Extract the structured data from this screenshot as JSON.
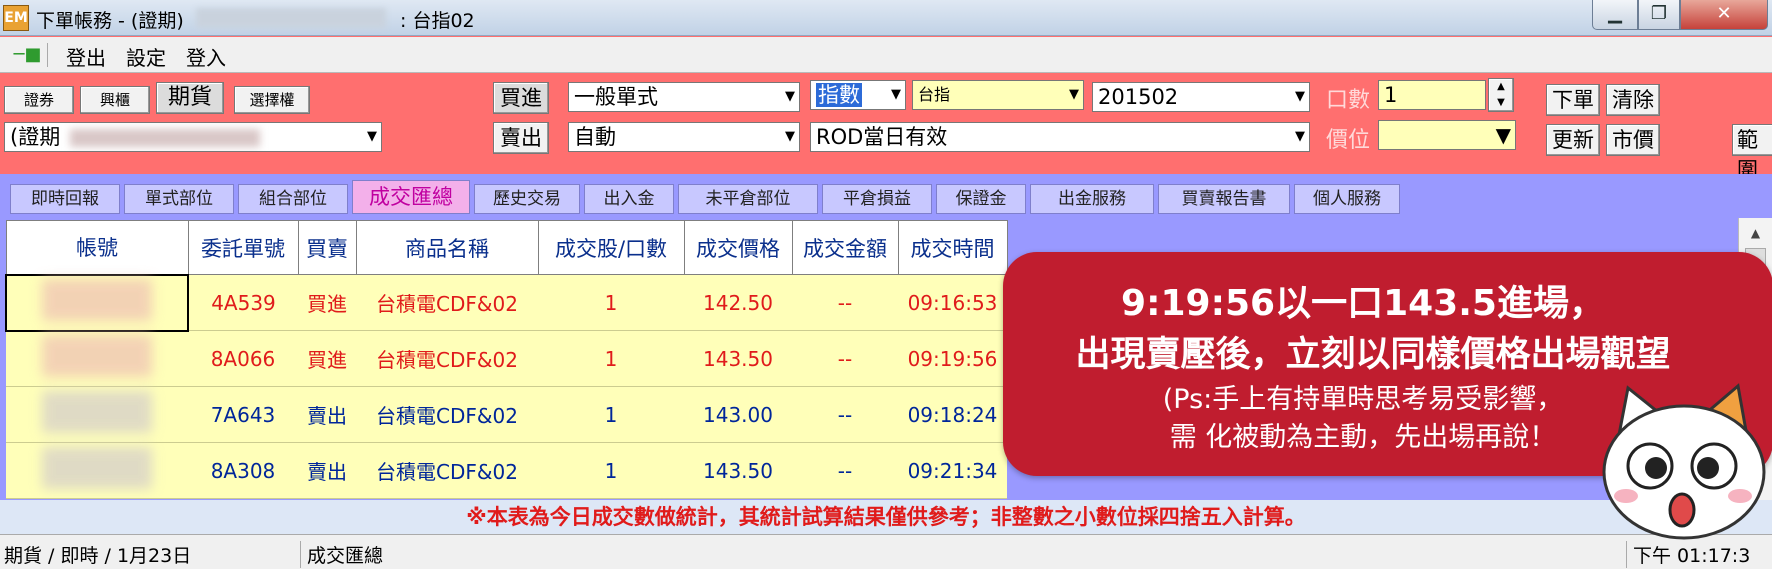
{
  "window": {
    "app_icon": "EM",
    "title": "下單帳務 - (證期)",
    "title_suffix": ": 台指02",
    "minimize": "▁",
    "maximize": "❐",
    "close": "✕"
  },
  "menu": {
    "pin_icon": "pin-icon",
    "items": [
      "登出",
      "設定",
      "登入"
    ]
  },
  "toolbar": {
    "market_buttons": [
      "證券",
      "興櫃",
      "期貨",
      "選擇權"
    ],
    "account_prefix": "(證期",
    "buy": "買進",
    "sell": "賣出",
    "order_type": "一般單式",
    "auto": "自動",
    "index_kind": "指數",
    "product": "台指",
    "month": "201502",
    "validity": "ROD當日有效",
    "qty_label": "口數",
    "qty_value": "1",
    "price_label": "價位",
    "actions": [
      "下單",
      "清除",
      "更新",
      "市價",
      "範圍"
    ]
  },
  "tabs": [
    "即時回報",
    "單式部位",
    "組合部位",
    "成交匯總",
    "歷史交易",
    "出入金",
    "未平倉部位",
    "平倉損益",
    "保證金",
    "出金服務",
    "買賣報告書",
    "個人服務"
  ],
  "table": {
    "headers": [
      "帳號",
      "委託單號",
      "買賣",
      "商品名稱",
      "成交股/口數",
      "成交價格",
      "成交金額",
      "成交時間"
    ],
    "rows": [
      {
        "order": "4A539",
        "side": "買進",
        "product": "台積電CDF&02",
        "qty": "1",
        "price": "142.50",
        "amount": "--",
        "time": "09:16:53"
      },
      {
        "order": "8A066",
        "side": "買進",
        "product": "台積電CDF&02",
        "qty": "1",
        "price": "143.50",
        "amount": "--",
        "time": "09:19:56"
      },
      {
        "order": "7A643",
        "side": "賣出",
        "product": "台積電CDF&02",
        "qty": "1",
        "price": "143.00",
        "amount": "--",
        "time": "09:18:24"
      },
      {
        "order": "8A308",
        "side": "賣出",
        "product": "台積電CDF&02",
        "qty": "1",
        "price": "143.50",
        "amount": "--",
        "time": "09:21:34"
      }
    ]
  },
  "note": "※本表為今日成交數做統計，其統計試算結果僅供參考；非整數之小數位採四捨五入計算。",
  "status": {
    "mode": "期貨 / 即時 /  1月23日",
    "page": "成交匯總",
    "time": "下午 01:17:3"
  },
  "callout": {
    "line1": "9:19:56以一口143.5進場，",
    "line2": "出現賣壓後，立刻以同樣價格出場觀望",
    "line3": "(Ps:手上有持單時思考易受影響，",
    "line4": "需 化被動為主動，先出場再說！"
  },
  "colors": {
    "toolbar_bg": "#ff6f6f",
    "tabbar_bg": "#9999ff",
    "row_bg": "#ffffb9",
    "buy_text": "#e01b1b",
    "sell_text": "#00269a",
    "callout_bg": "#c01d2f"
  }
}
